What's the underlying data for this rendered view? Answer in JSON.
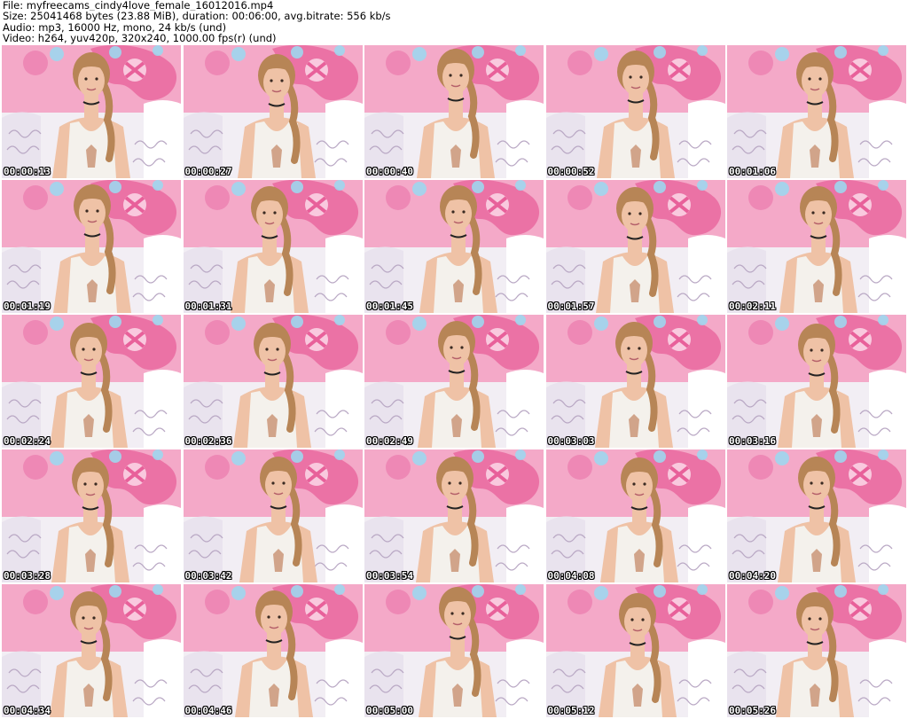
{
  "header": {
    "file_line": "File: myfreecams_cindy4love_female_16012016.mp4",
    "size_line": "Size: 25041468 bytes (23.88 MiB), duration: 00:06:00, avg.bitrate: 556 kb/s",
    "audio_line": "Audio: mp3, 16000 Hz, mono, 24 kb/s (und)",
    "video_line": "Video: h264, yuv420p, 320x240, 1000.00 fps(r) (und)"
  },
  "thumbnails": [
    {
      "timestamp": "00:00:13"
    },
    {
      "timestamp": "00:00:27"
    },
    {
      "timestamp": "00:00:40"
    },
    {
      "timestamp": "00:00:52"
    },
    {
      "timestamp": "00:01:06"
    },
    {
      "timestamp": "00:01:19"
    },
    {
      "timestamp": "00:01:31"
    },
    {
      "timestamp": "00:01:45"
    },
    {
      "timestamp": "00:01:57"
    },
    {
      "timestamp": "00:02:11"
    },
    {
      "timestamp": "00:02:24"
    },
    {
      "timestamp": "00:02:36"
    },
    {
      "timestamp": "00:02:49"
    },
    {
      "timestamp": "00:03:03"
    },
    {
      "timestamp": "00:03:16"
    },
    {
      "timestamp": "00:03:28"
    },
    {
      "timestamp": "00:03:42"
    },
    {
      "timestamp": "00:03:54"
    },
    {
      "timestamp": "00:04:08"
    },
    {
      "timestamp": "00:04:20"
    },
    {
      "timestamp": "00:04:34"
    },
    {
      "timestamp": "00:04:46"
    },
    {
      "timestamp": "00:05:00"
    },
    {
      "timestamp": "00:05:12"
    },
    {
      "timestamp": "00:05:26"
    }
  ],
  "colors": {
    "background_pink": "#f4a9c8",
    "banner_pink": "#e8609a",
    "bedding": "#f2eef4",
    "top_white": "#f4f1ec",
    "skin": "#efc2a6",
    "hair": "#b78556",
    "timestamp_text": "#ffffff"
  }
}
